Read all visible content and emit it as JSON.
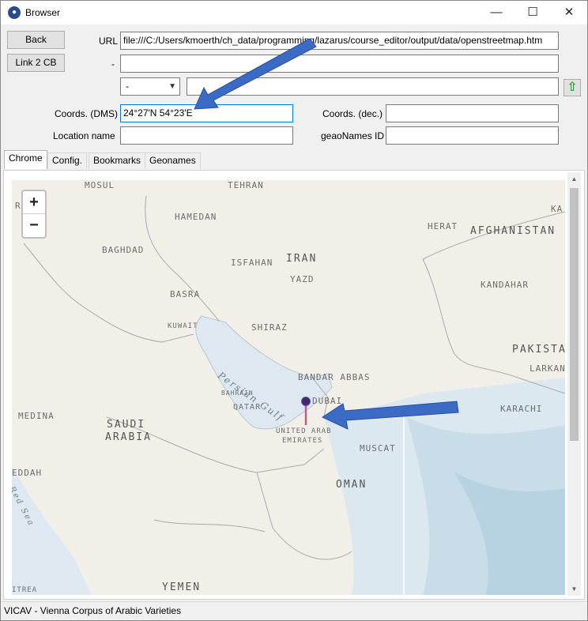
{
  "window": {
    "title": "Browser",
    "minimize": "—",
    "maximize": "☐",
    "close": "✕",
    "icon": "paw-icon"
  },
  "toolbar": {
    "back_label": "Back",
    "link_label": "Link 2 CB"
  },
  "form": {
    "url_label": "URL",
    "url_value": "file:///C:/Users/kmoerth/ch_data/programming/lazarus/course_editor/output/data/openstreetmap.htm",
    "dash_label": "-",
    "second_value": "",
    "combo_value": "-",
    "combo_text_value": "",
    "up_icon": "⇧",
    "coords_dms_label": "Coords. (DMS)",
    "coords_dms_value": "24°27'N 54°23'E",
    "coords_dec_label": "Coords. (dec.)",
    "coords_dec_value": "",
    "location_label": "Location name",
    "location_value": "",
    "geonames_label": "geaoNames ID",
    "geonames_value": ""
  },
  "tabs": [
    {
      "label": "Chrome",
      "active": true
    },
    {
      "label": "Config."
    },
    {
      "label": "Bookmarks"
    },
    {
      "label": "Geonames"
    }
  ],
  "map": {
    "zoom_in": "+",
    "zoom_out": "−",
    "labels": {
      "mosul": "MOSUL",
      "tehran": "TEHRAN",
      "hamedan": "HAMEDAN",
      "baghdad": "BAGHDAD",
      "isfahan": "ISFAHAN",
      "iran": "IRAN",
      "yazd": "YAZD",
      "basra": "BASRA",
      "kuwait": "KUWAIT",
      "shiraz": "SHIRAZ",
      "herat": "HERAT",
      "afghanistan": "AFGHANISTAN",
      "kandahar": "KANDAHAR",
      "pakistan": "PAKISTA",
      "larkana": "LARKAN",
      "karachi": "KARACHI",
      "persian_gulf": "Persian Gulf",
      "bandar_abbas": "BANDAR ABBAS",
      "dubai": "DUBAI",
      "bahrain": "BAHRAIN",
      "qatar": "QATAR",
      "uae": "UNITED ARAB",
      "uae2": "EMIRATES",
      "muscat": "MUSCAT",
      "medina": "MEDINA",
      "saudi": "SAUDI",
      "arabia": "ARABIA",
      "oman": "OMAN",
      "jeddah": "EDDAH",
      "red_sea": "Red Sea",
      "yemen": "YEMEN",
      "eritrea": "ITREA",
      "ka": "KA",
      "r": "R"
    }
  },
  "status": {
    "text": "VICAV - Vienna Corpus of Arabic Varieties"
  },
  "colors": {
    "accent": "#0078d7",
    "arrow": "#3b6bc4",
    "marker": "#3f2a6b",
    "sea": "#dbe8f0"
  }
}
